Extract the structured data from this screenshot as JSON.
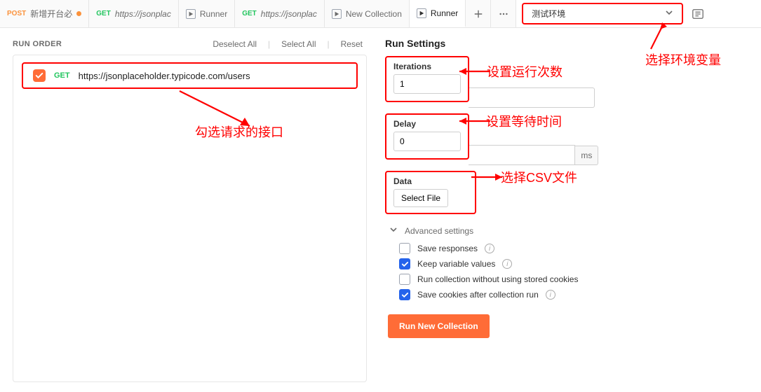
{
  "tabs": [
    {
      "kind": "request",
      "method": "POST",
      "method_class": "post",
      "label": "新增开台必",
      "dirty": true
    },
    {
      "kind": "request",
      "method": "GET",
      "method_class": "get",
      "label": "https://jsonplac",
      "dirty": false,
      "italic": true
    },
    {
      "kind": "runner",
      "label": "Runner"
    },
    {
      "kind": "request",
      "method": "GET",
      "method_class": "get",
      "label": "https://jsonplac",
      "dirty": false,
      "italic": true
    },
    {
      "kind": "runner",
      "label": "New Collection"
    },
    {
      "kind": "runner",
      "label": "Runner",
      "active": true
    }
  ],
  "env": {
    "selected": "测试环境"
  },
  "run_order": {
    "title": "RUN ORDER",
    "actions": {
      "deselect": "Deselect All",
      "select": "Select All",
      "reset": "Reset"
    },
    "items": [
      {
        "checked": true,
        "method": "GET",
        "url": "https://jsonplaceholder.typicode.com/users"
      }
    ]
  },
  "settings": {
    "title": "Run Settings",
    "iterations": {
      "label": "Iterations",
      "value": "1"
    },
    "delay": {
      "label": "Delay",
      "value": "0",
      "suffix": "ms"
    },
    "data": {
      "label": "Data",
      "select_file": "Select File"
    },
    "advanced_label": "Advanced settings",
    "options": [
      {
        "key": "save_responses",
        "label": "Save responses",
        "checked": false,
        "info": true
      },
      {
        "key": "keep_vars",
        "label": "Keep variable values",
        "checked": true,
        "info": true
      },
      {
        "key": "no_cookies",
        "label": "Run collection without using stored cookies",
        "checked": false,
        "info": false
      },
      {
        "key": "save_cookies",
        "label": "Save cookies after collection run",
        "checked": true,
        "info": true
      }
    ],
    "run_button": "Run New Collection"
  },
  "annotations": {
    "env": "选择环境变量",
    "iter": "设置运行次数",
    "delay": "设置等待时间",
    "data": "选择CSV文件",
    "pick": "勾选请求的接口"
  }
}
